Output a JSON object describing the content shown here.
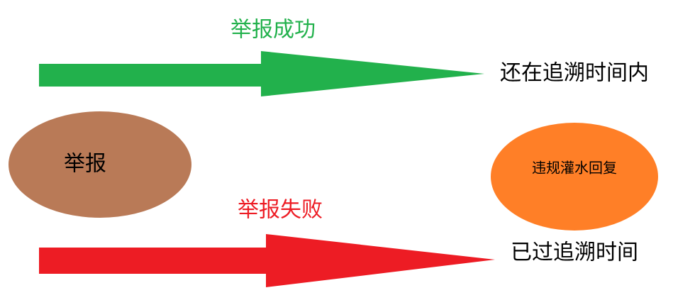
{
  "colors": {
    "background": "#ffffff",
    "success": "#22b14c",
    "failure": "#ed1c24",
    "report_node": "#b97a57",
    "violation_node": "#ff7f27",
    "text_dark": "#000000"
  },
  "nodes": {
    "report": {
      "label": "举报"
    },
    "violation": {
      "label": "违规灌水回复"
    }
  },
  "arrows": {
    "success": {
      "label": "举报成功",
      "target_label": "还在追溯时间内"
    },
    "failure": {
      "label": "举报失败",
      "target_label": "已过追溯时间"
    }
  }
}
